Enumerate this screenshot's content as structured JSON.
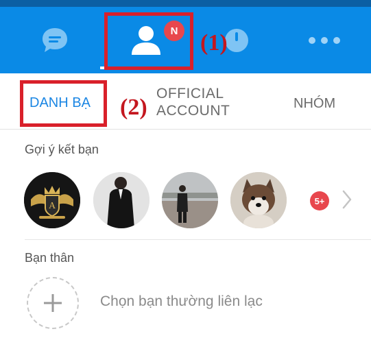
{
  "topbar": {
    "contacts_badge": "N",
    "icons": [
      "chat-icon",
      "contacts-icon",
      "timeline-icon",
      "more-icon"
    ]
  },
  "annotations": {
    "step1": "(1)",
    "step2": "(2)"
  },
  "tabs": {
    "contacts": "DANH BẠ",
    "official_line1": "OFFICIAL",
    "official_line2": "ACCOUNT",
    "groups": "NHÓM"
  },
  "suggestions": {
    "title": "Gợi ý kết bạn",
    "more_badge": "5+"
  },
  "close_friends": {
    "title": "Bạn thân",
    "add_label": "Chọn bạn thường liên lạc"
  },
  "colors": {
    "bar": "#0a8ae6",
    "active_tab": "#1b86e3",
    "badge": "#e8474d",
    "annotation": "#d9202a"
  }
}
